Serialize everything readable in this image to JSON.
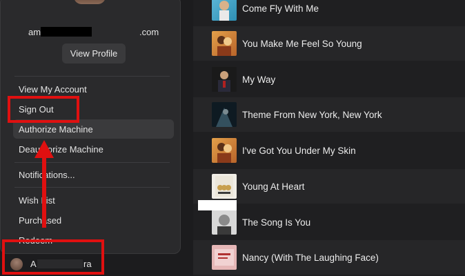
{
  "account_menu": {
    "email_prefix": "am",
    "email_suffix": ".com",
    "view_profile_label": "View Profile",
    "items": [
      {
        "label": "View My Account"
      },
      {
        "label": "Sign Out"
      },
      {
        "label": "Authorize Machine"
      },
      {
        "label": "Deauthorize Machine"
      },
      {
        "label": "Notifications..."
      },
      {
        "label": "Wish List"
      },
      {
        "label": "Purchased"
      },
      {
        "label": "Redeem"
      }
    ]
  },
  "account_bar": {
    "name_first": "A",
    "name_last": "ra"
  },
  "songs": [
    {
      "title": "Come Fly With Me"
    },
    {
      "title": "You Make Me Feel So Young"
    },
    {
      "title": "My Way"
    },
    {
      "title": "Theme From New York, New York"
    },
    {
      "title": "I've Got You Under My Skin"
    },
    {
      "title": "Young At Heart"
    },
    {
      "title": "The Song Is You"
    },
    {
      "title": "Nancy (With The Laughing Face)"
    }
  ],
  "colors": {
    "annotation": "#e01010",
    "panel_bg": "#2a2a2c",
    "list_bg": "#1f1f21"
  }
}
